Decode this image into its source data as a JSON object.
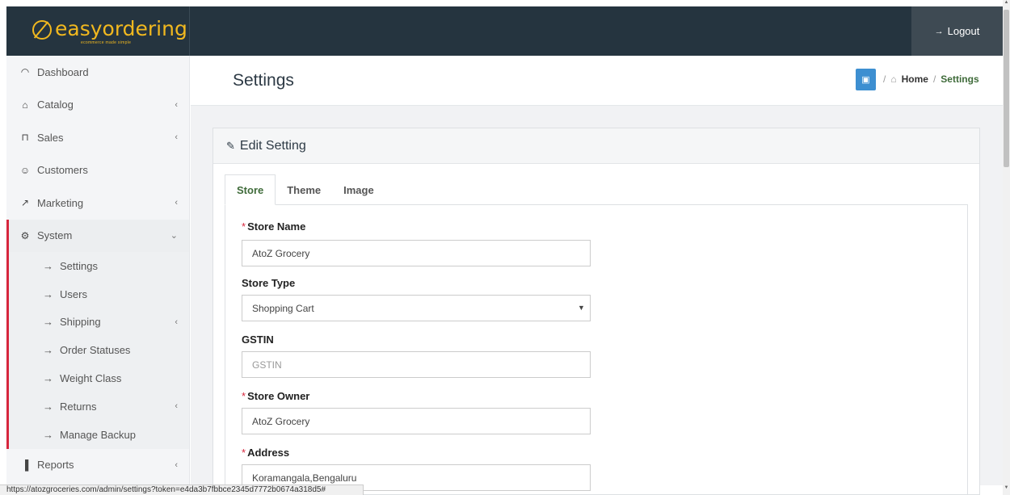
{
  "brand": {
    "name": "easyordering",
    "tagline": "ecommerce made simple",
    "accent": "#f1b81f",
    "topbar_color": "#25343f"
  },
  "header": {
    "logout_label": "Logout",
    "logout_icon": "sign-out-icon"
  },
  "sidebar": {
    "items": [
      {
        "label": "Dashboard",
        "icon": "dashboard-icon",
        "has_children": false
      },
      {
        "label": "Catalog",
        "icon": "tag-icon",
        "has_children": true
      },
      {
        "label": "Sales",
        "icon": "cart-icon",
        "has_children": true
      },
      {
        "label": "Customers",
        "icon": "user-icon",
        "has_children": false
      },
      {
        "label": "Marketing",
        "icon": "share-icon",
        "has_children": true
      },
      {
        "label": "System",
        "icon": "gear-icon",
        "has_children": true,
        "expanded": true
      },
      {
        "label": "Reports",
        "icon": "bar-chart-icon",
        "has_children": true
      }
    ],
    "system_children": [
      {
        "label": "Settings",
        "has_children": false
      },
      {
        "label": "Users",
        "has_children": false
      },
      {
        "label": "Shipping",
        "has_children": true
      },
      {
        "label": "Order Statuses",
        "has_children": false
      },
      {
        "label": "Weight Class",
        "has_children": false
      },
      {
        "label": "Returns",
        "has_children": true
      },
      {
        "label": "Manage Backup",
        "has_children": false
      }
    ],
    "active_accent": "#d7263d"
  },
  "page": {
    "title": "Settings",
    "breadcrumb": {
      "home": "Home",
      "current": "Settings"
    }
  },
  "panel": {
    "title": "Edit Setting",
    "tabs": [
      "Store",
      "Theme",
      "Image"
    ],
    "active_tab": "Store"
  },
  "form": {
    "store_name": {
      "label": "Store Name",
      "required": true,
      "value": "AtoZ Grocery"
    },
    "store_type": {
      "label": "Store Type",
      "required": false,
      "value": "Shopping Cart"
    },
    "gstin": {
      "label": "GSTIN",
      "required": false,
      "value": "",
      "placeholder": "GSTIN"
    },
    "store_owner": {
      "label": "Store Owner",
      "required": true,
      "value": "AtoZ Grocery"
    },
    "address": {
      "label": "Address",
      "required": true,
      "value": "Koramangala,Bengaluru"
    }
  },
  "statusbar": {
    "url": "https://atozgroceries.com/admin/settings?token=e4da3b7fbbce2345d7772b0674a318d5#"
  }
}
